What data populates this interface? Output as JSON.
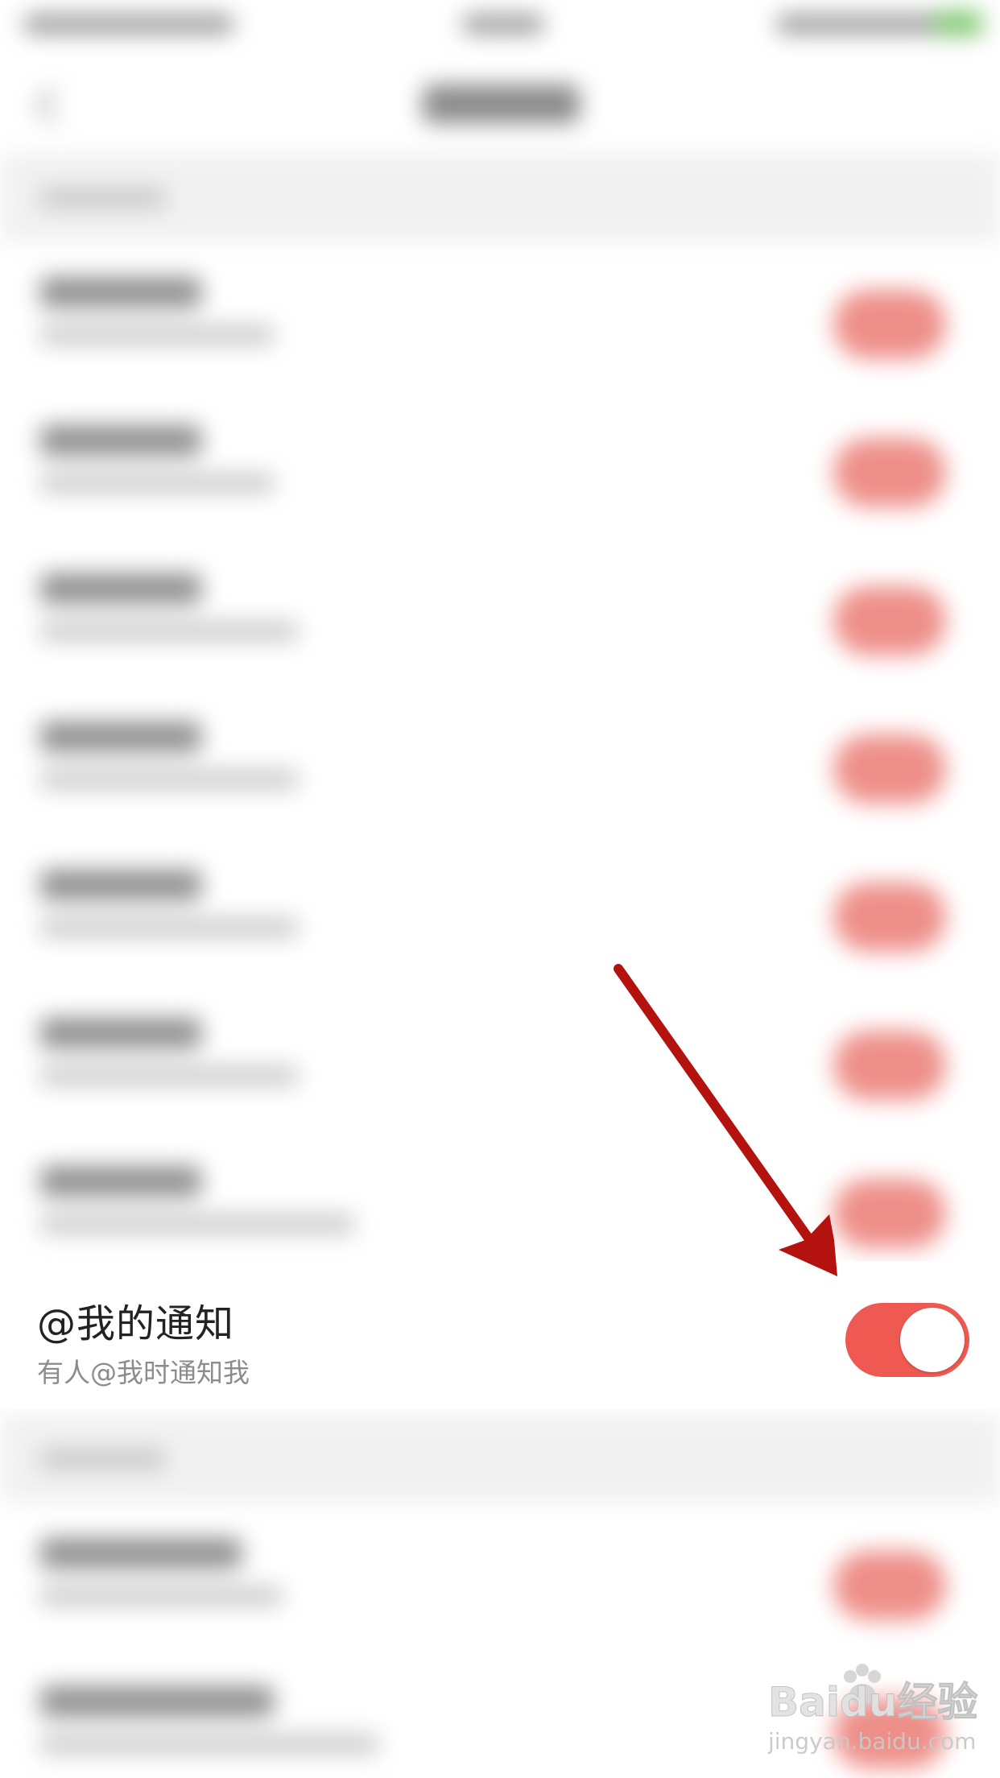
{
  "highlighted_row": {
    "title": "@我的通知",
    "subtitle": "有人@我时通知我",
    "toggle_on": true
  },
  "colors": {
    "toggle_active": "#ee5a52",
    "annotation_arrow": "#b3120e",
    "title_text": "#222222",
    "subtitle_text": "#8c8c8c"
  },
  "watermark": {
    "brand": "Baidu经验",
    "url": "jingyan.baidu.com"
  },
  "icons": [
    "back-arrow-icon",
    "annotation-arrow-icon",
    "baidu-paw-icon"
  ]
}
